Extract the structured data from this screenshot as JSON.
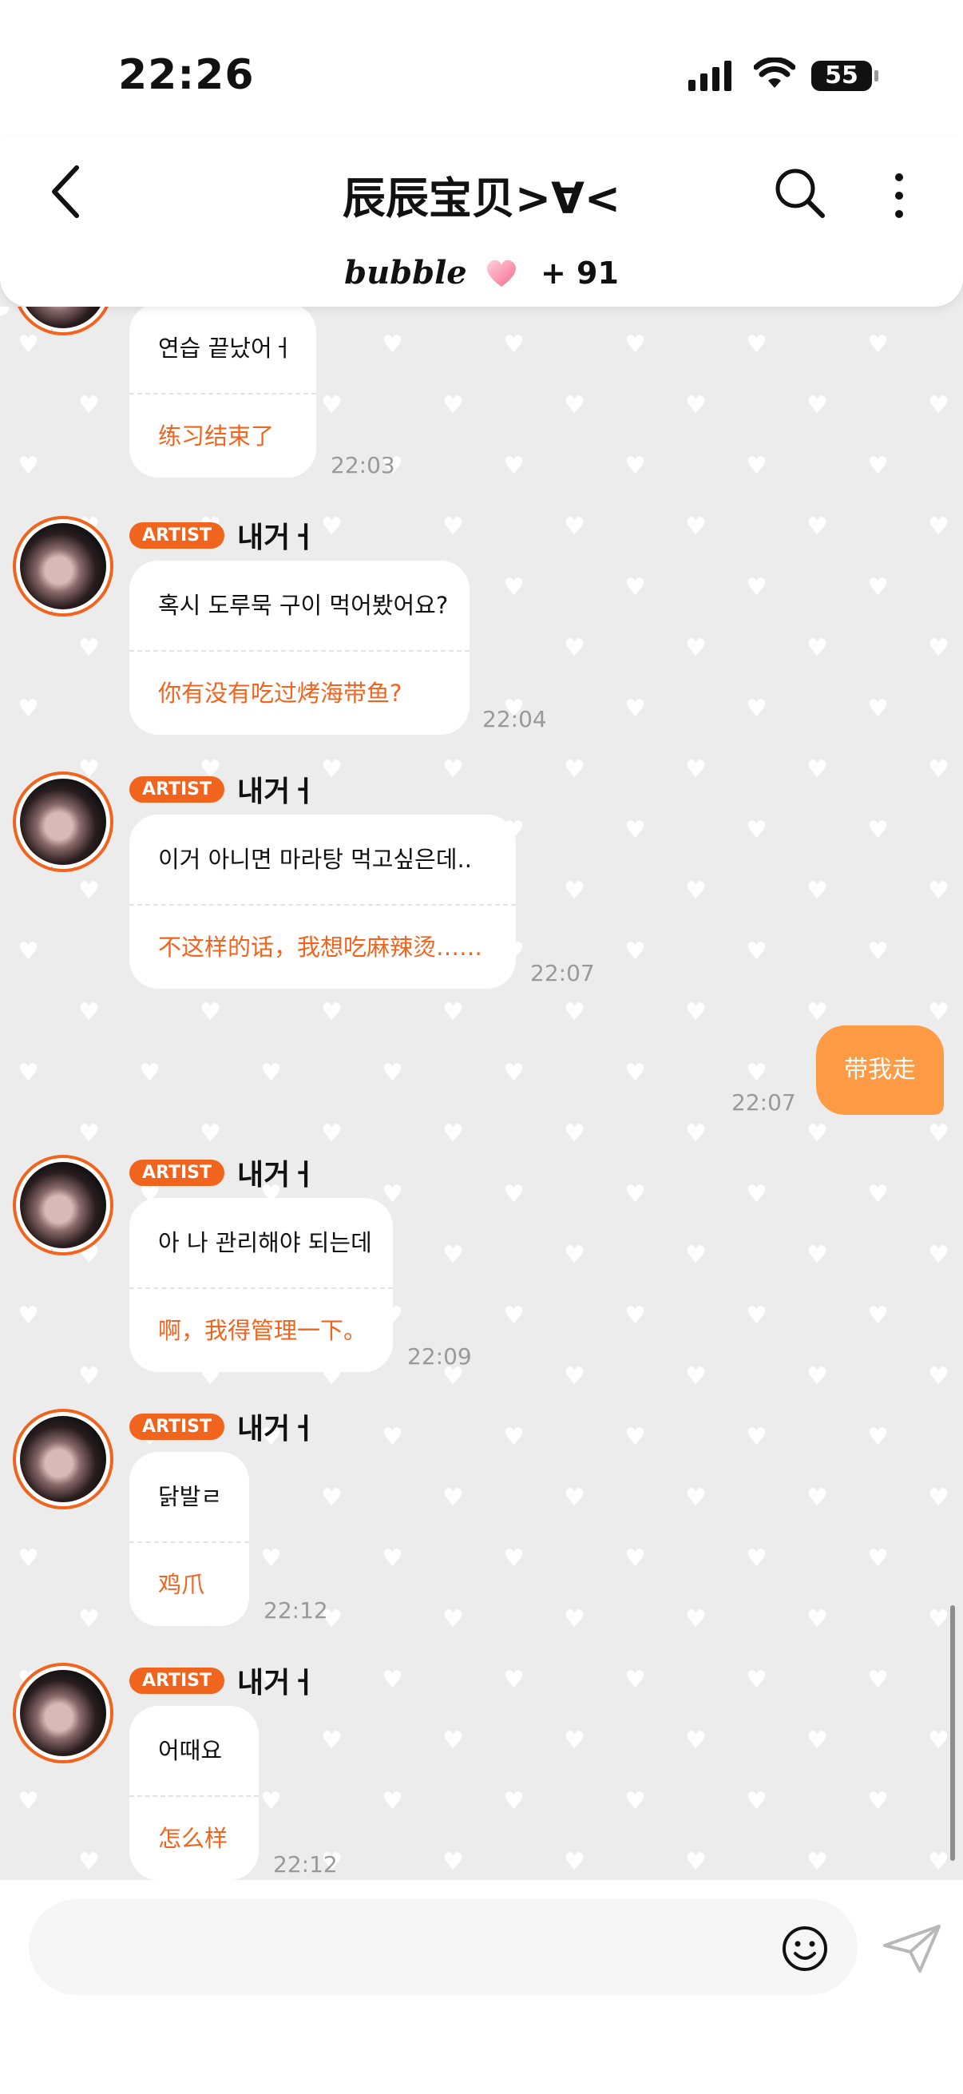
{
  "status_bar": {
    "time": "22:26",
    "battery": "55"
  },
  "header": {
    "title": "辰辰宝贝>∀<",
    "bubble_word": "bubble",
    "bubble_count": "+ 91"
  },
  "badge_label": "ARTIST",
  "messages": [
    {
      "orig": "연습 끝났어ㅓ",
      "trans": "练习结束了",
      "time": "22:03"
    },
    {
      "sender": "내거ㅓ",
      "orig": "혹시 도루묵 구이 먹어봤어요?",
      "trans": "你有没有吃过烤海带鱼?",
      "time": "22:04"
    },
    {
      "sender": "내거ㅓ",
      "orig": "이거 아니면 마라탕 먹고싶은데..",
      "trans": "不这样的话，我想吃麻辣烫……",
      "time": "22:07"
    },
    {
      "sender": "내거ㅓ",
      "orig": "아 나 관리해야 되는데",
      "trans": "啊，我得管理一下。",
      "time": "22:09"
    },
    {
      "sender": "내거ㅓ",
      "orig": "닭발ㄹ",
      "trans": "鸡爪",
      "time": "22:12"
    },
    {
      "sender": "내거ㅓ",
      "orig": "어때요",
      "trans": "怎么样",
      "time": "22:12"
    }
  ],
  "my_message": {
    "text": "带我走",
    "time": "22:07"
  },
  "icons": [
    "back-icon",
    "search-icon",
    "more-icon",
    "heart-icon",
    "emoji-icon",
    "send-icon"
  ]
}
